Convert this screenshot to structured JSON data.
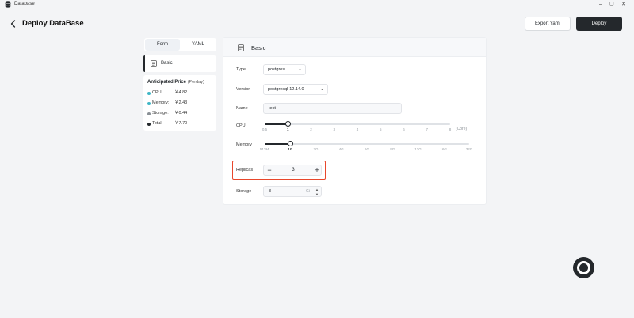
{
  "window": {
    "title": "Database",
    "controls": {
      "minimize": "–",
      "maximize": "▢",
      "close": "✕"
    }
  },
  "header": {
    "title": "Deploy DataBase",
    "export_label": "Export Yaml",
    "deploy_label": "Deploy"
  },
  "sidebar": {
    "tabs": [
      {
        "label": "Form",
        "active": true
      },
      {
        "label": "YAML",
        "active": false
      }
    ],
    "nav_item": {
      "label": "Basic"
    },
    "price": {
      "title": "Anticipated Price",
      "subtitle": "(Perday)",
      "items": [
        {
          "label": "CPU:",
          "value": "￥4.82",
          "color": "#3fb6c6"
        },
        {
          "label": "Memory:",
          "value": "￥2.43",
          "color": "#3fb6c6"
        },
        {
          "label": "Storage:",
          "value": "￥0.44",
          "color": "#8a9096"
        },
        {
          "label": "Total:",
          "value": "￥7.70",
          "color": "#24282c"
        }
      ]
    }
  },
  "form": {
    "section_title": "Basic",
    "type": {
      "label": "Type",
      "value": "postgres"
    },
    "version": {
      "label": "Version",
      "value": "postgresql-12.14.0"
    },
    "name": {
      "label": "Name",
      "value": "test"
    },
    "cpu": {
      "label": "CPU",
      "ticks": [
        "0.5",
        "1",
        "2",
        "3",
        "4",
        "5",
        "6",
        "7",
        "8"
      ],
      "selected_index": 1,
      "unit": "(Core)"
    },
    "memory": {
      "label": "Memory",
      "ticks": [
        "512Mi",
        "1G",
        "2G",
        "4G",
        "6G",
        "8G",
        "12G",
        "16G",
        "32G"
      ],
      "selected_index": 1
    },
    "replicas": {
      "label": "Replicas",
      "value": "3",
      "minus": "−",
      "plus": "+"
    },
    "storage": {
      "label": "Storage",
      "value": "3",
      "unit": "Gi"
    }
  },
  "colors": {
    "accent": "#24282c",
    "highlight": "#e8472c",
    "background": "#f3f4f6"
  }
}
